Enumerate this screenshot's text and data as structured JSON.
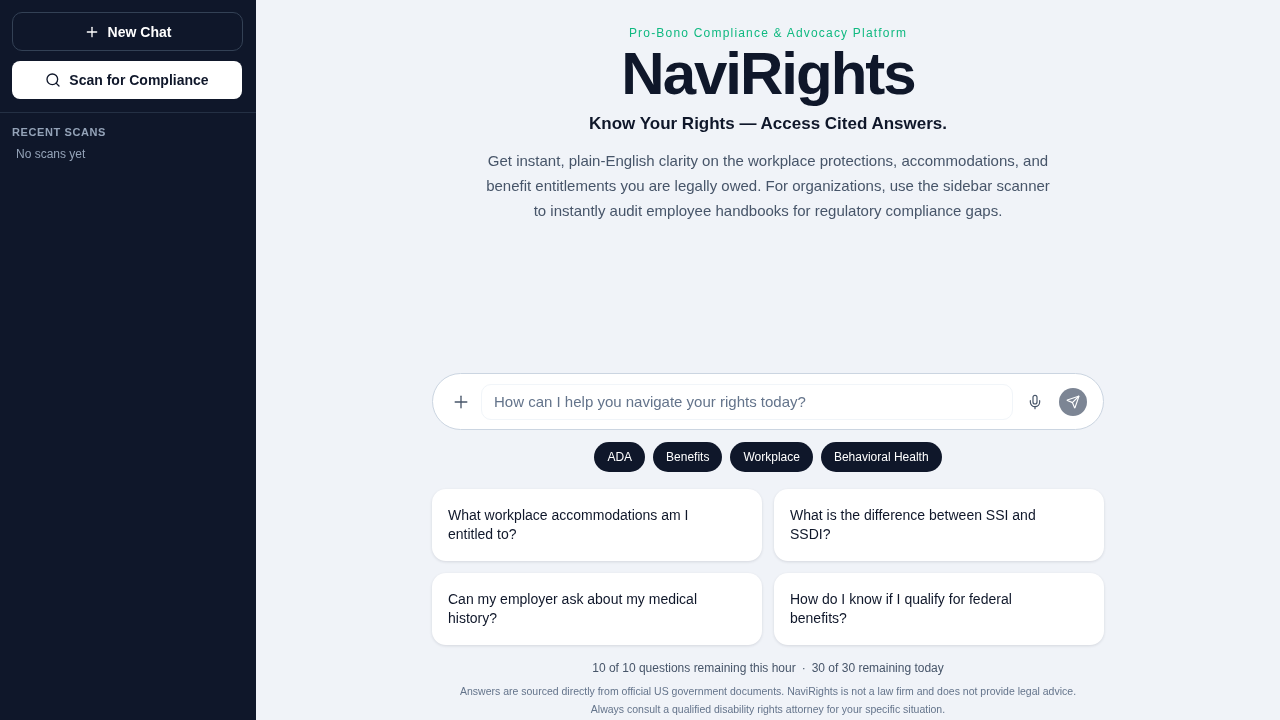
{
  "sidebar": {
    "new_chat_button": "New Chat",
    "scan_button": "Scan for Compliance",
    "recent_scans": {
      "title": "RECENT SCANS",
      "empty_text": "No scans yet"
    }
  },
  "header": {
    "tagline": "Pro-Bono Compliance & Advocacy Platform",
    "title": "NaviRights",
    "subtitle": "Know Your Rights — Access Cited Answers.",
    "description": "Get instant, plain-English clarity on the workplace protections, accommodations, and benefit entitlements you are legally owed. For organizations, use the sidebar scanner to instantly audit employee handbooks for regulatory compliance gaps."
  },
  "composer": {
    "placeholder": "How can I help you navigate your rights today?",
    "send_disabled": true
  },
  "topic_chips": [
    "ADA",
    "Benefits",
    "Workplace",
    "Behavioral Health"
  ],
  "suggestions": [
    "What workplace accommodations am I entitled to?",
    "What is the difference between SSI and SSDI?",
    "Can my employer ask about my medical history?",
    "How do I know if I qualify for federal benefits?"
  ],
  "usage": {
    "hourly": "10 of 10 questions remaining this hour",
    "separator": "·",
    "daily": "30 of 30 remaining today"
  },
  "disclaimer": [
    "Answers are sourced directly from official US government documents. NaviRights is not a law firm and does not provide legal advice.",
    "Always consult a qualified disability rights attorney for your specific situation."
  ]
}
